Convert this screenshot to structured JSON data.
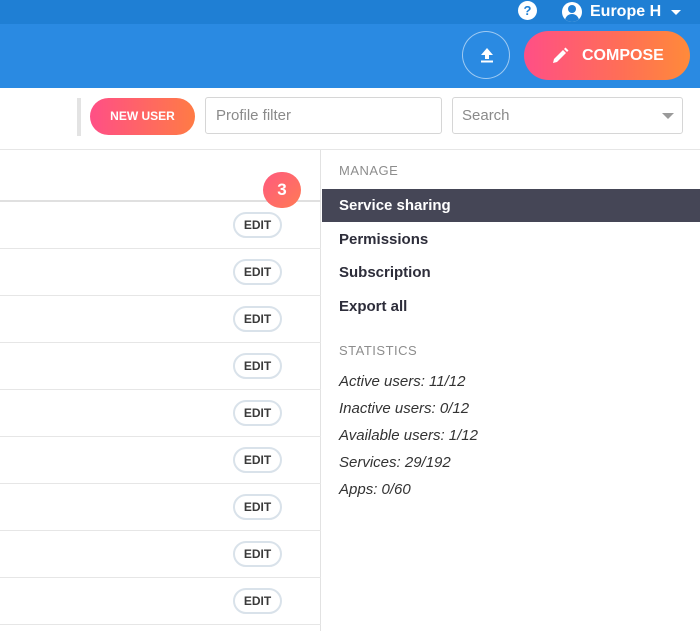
{
  "topbar": {
    "account_name": "Europe H"
  },
  "header": {
    "compose_label": "COMPOSE"
  },
  "toolbar": {
    "new_user_label": "NEW USER",
    "profile_filter_placeholder": "Profile filter",
    "search_placeholder": "Search"
  },
  "list": {
    "badge_count": "3",
    "rows": [
      {
        "edit_label": "EDIT"
      },
      {
        "edit_label": "EDIT"
      },
      {
        "edit_label": "EDIT"
      },
      {
        "edit_label": "EDIT"
      },
      {
        "edit_label": "EDIT"
      },
      {
        "edit_label": "EDIT"
      },
      {
        "edit_label": "EDIT"
      },
      {
        "edit_label": "EDIT"
      },
      {
        "edit_label": "EDIT"
      }
    ]
  },
  "sidebar": {
    "manage_title": "MANAGE",
    "manage_items": [
      {
        "label": "Service sharing",
        "active": true
      },
      {
        "label": "Permissions"
      },
      {
        "label": "Subscription"
      },
      {
        "label": "Export all"
      }
    ],
    "statistics_title": "STATISTICS",
    "stats": [
      "Active users: 11/12",
      "Inactive users: 0/12",
      "Available users: 1/12",
      "Services: 29/192",
      "Apps: 0/60"
    ]
  },
  "colors": {
    "topbar": "#1f7fd4",
    "header": "#2a8ae2",
    "accent_gradient_start": "#ff4f86",
    "accent_gradient_end": "#ff8a3a",
    "active_menu_bg": "#454656"
  }
}
